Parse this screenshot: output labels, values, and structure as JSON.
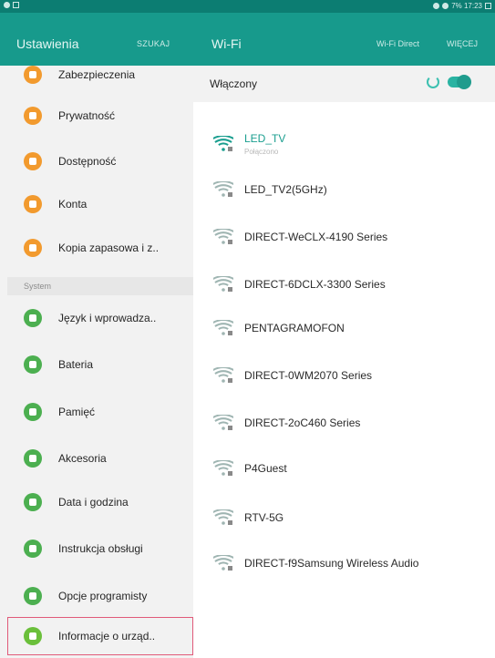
{
  "status_bar": {
    "right_text": "7% 17:23",
    "icons": [
      "notification-icon",
      "image-icon",
      "signal-icon",
      "wifi-icon",
      "battery-icon"
    ]
  },
  "app_bar": {
    "title": "Ustawienia",
    "search_label": "SZUKAJ",
    "wifi_title": "Wi-Fi",
    "wifi_direct_label": "Wi-Fi Direct",
    "more_label": "WIĘCEJ",
    "colors": {
      "primary": "#179a8c",
      "status_bar": "#0c7d72"
    }
  },
  "sidebar": {
    "items": [
      {
        "label": "Zabezpieczenia",
        "icon": "lock-icon",
        "color": "#f29a2e"
      },
      {
        "label": "Prywatność",
        "icon": "privacy-icon",
        "color": "#f29a2e"
      },
      {
        "label": "Dostępność",
        "icon": "accessibility-icon",
        "color": "#f29a2e"
      },
      {
        "label": "Konta",
        "icon": "key-icon",
        "color": "#f29a2e"
      },
      {
        "label": "Kopia zapasowa i z..",
        "icon": "backup-icon",
        "color": "#f29a2e"
      }
    ],
    "section_header": "System",
    "system_items": [
      {
        "label": "Język i wprowadza..",
        "icon": "language-icon",
        "color": "#4caf50"
      },
      {
        "label": "Bateria",
        "icon": "battery-icon",
        "color": "#4caf50"
      },
      {
        "label": "Pamięć",
        "icon": "storage-icon",
        "color": "#4caf50"
      },
      {
        "label": "Akcesoria",
        "icon": "accessories-icon",
        "color": "#4caf50"
      },
      {
        "label": "Data i godzina",
        "icon": "calendar-icon",
        "color": "#4caf50"
      },
      {
        "label": "Instrukcja obsługi",
        "icon": "manual-icon",
        "color": "#4caf50"
      },
      {
        "label": "Opcje programisty",
        "icon": "developer-icon",
        "color": "#4caf50"
      },
      {
        "label": "Informacje o urząd..",
        "icon": "info-icon",
        "color": "#6abf3a"
      }
    ],
    "highlight_color": "#e05a79"
  },
  "wifi": {
    "toggle_label": "Włączony",
    "toggle_on": true,
    "networks": [
      {
        "name": "LED_TV",
        "status": "Połączono",
        "connected": true
      },
      {
        "name": "LED_TV2(5GHz)",
        "status": "",
        "connected": false
      },
      {
        "name": "DIRECT-WeCLX-4190 Series",
        "status": "",
        "connected": false
      },
      {
        "name": "DIRECT-6DCLX-3300 Series",
        "status": "",
        "connected": false
      },
      {
        "name": "PENTAGRAMOFON",
        "status": "",
        "connected": false
      },
      {
        "name": "DIRECT-0WM2070 Series",
        "status": "",
        "connected": false
      },
      {
        "name": "DIRECT-2oC460 Series",
        "status": "",
        "connected": false
      },
      {
        "name": "P4Guest",
        "status": "",
        "connected": false
      },
      {
        "name": "RTV-5G",
        "status": "",
        "connected": false
      },
      {
        "name": "DIRECT-f9Samsung Wireless Audio",
        "status": "",
        "connected": false
      }
    ]
  }
}
